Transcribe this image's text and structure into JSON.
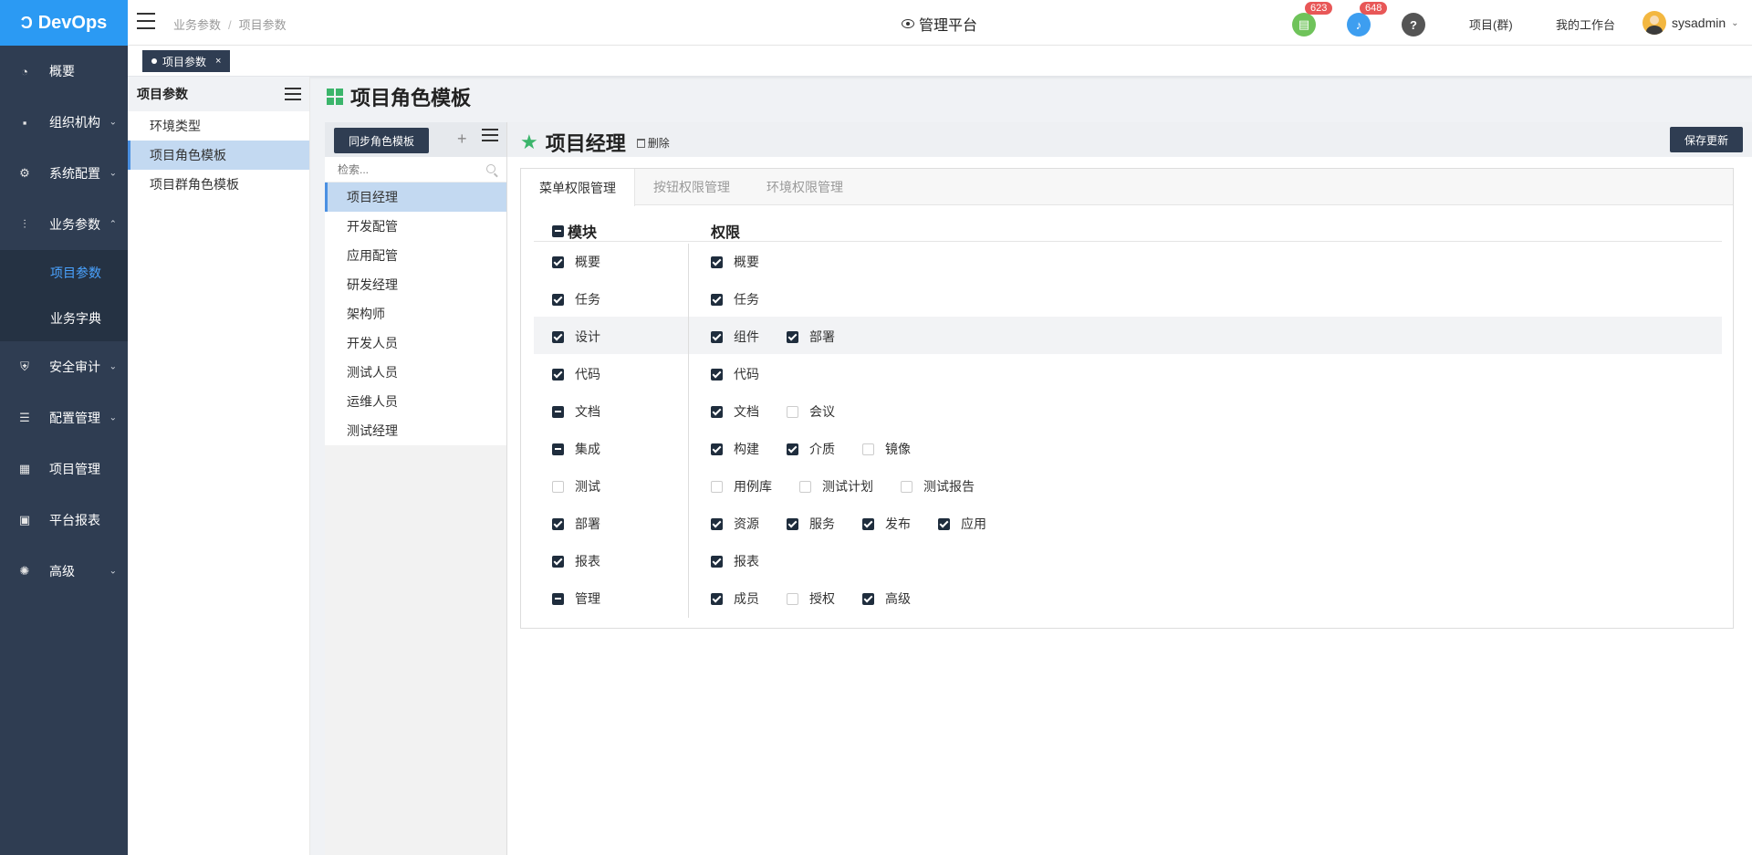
{
  "logo": {
    "text": "DevOps"
  },
  "sidebar": {
    "items": [
      {
        "label": "概要",
        "icon": "dashboard-icon"
      },
      {
        "label": "组织机构",
        "icon": "lock-icon"
      },
      {
        "label": "系统配置",
        "icon": "gear-icon"
      },
      {
        "label": "业务参数",
        "icon": "sliders-icon"
      },
      {
        "label": "安全审计",
        "icon": "shield-icon"
      },
      {
        "label": "配置管理",
        "icon": "database-icon"
      },
      {
        "label": "项目管理",
        "icon": "grid-icon"
      },
      {
        "label": "平台报表",
        "icon": "monitor-icon"
      },
      {
        "label": "高级",
        "icon": "cog-advanced-icon"
      }
    ],
    "subitems": [
      {
        "label": "项目参数",
        "active": true
      },
      {
        "label": "业务字典",
        "active": false
      }
    ]
  },
  "topbar": {
    "breadcrumb": [
      "业务参数",
      "项目参数"
    ],
    "breadcrumb_sep": "/",
    "platform": "管理平台",
    "badge_tasks": "623",
    "badge_notifications": "648",
    "help": "?",
    "project_group": "项目(群)",
    "workbench": "我的工作台",
    "username": "sysadmin",
    "colors": {
      "tasks": "#6fc35a",
      "notifications": "#3d9ef0",
      "help": "#555555"
    }
  },
  "tabstrip": {
    "tab_label": "项目参数",
    "close": "×"
  },
  "panel2": {
    "title": "项目参数",
    "items": [
      {
        "label": "环境类型"
      },
      {
        "label": "项目角色模板"
      },
      {
        "label": "项目群角色模板"
      }
    ]
  },
  "page": {
    "title": "项目角色模板"
  },
  "roles": {
    "sync_button": "同步角色模板",
    "add": "+",
    "search_placeholder": "检索...",
    "items": [
      "项目经理",
      "开发配管",
      "应用配管",
      "研发经理",
      "架构师",
      "开发人员",
      "测试人员",
      "运维人员",
      "测试经理"
    ]
  },
  "detail": {
    "role_title": "项目经理",
    "delete_label": "删除",
    "save_button": "保存更新",
    "tabs": [
      "菜单权限管理",
      "按钮权限管理",
      "环境权限管理"
    ],
    "col_module": "模块",
    "col_permission": "权限",
    "rows": [
      {
        "module": "概要",
        "state": "checked",
        "perms": [
          {
            "label": "概要",
            "checked": true
          }
        ]
      },
      {
        "module": "任务",
        "state": "checked",
        "perms": [
          {
            "label": "任务",
            "checked": true
          }
        ]
      },
      {
        "module": "设计",
        "state": "checked",
        "perms": [
          {
            "label": "组件",
            "checked": true
          },
          {
            "label": "部署",
            "checked": true
          }
        ]
      },
      {
        "module": "代码",
        "state": "checked",
        "perms": [
          {
            "label": "代码",
            "checked": true
          }
        ]
      },
      {
        "module": "文档",
        "state": "partial",
        "perms": [
          {
            "label": "文档",
            "checked": true
          },
          {
            "label": "会议",
            "checked": false
          }
        ]
      },
      {
        "module": "集成",
        "state": "partial",
        "perms": [
          {
            "label": "构建",
            "checked": true
          },
          {
            "label": "介质",
            "checked": true
          },
          {
            "label": "镜像",
            "checked": false
          }
        ]
      },
      {
        "module": "测试",
        "state": "empty",
        "perms": [
          {
            "label": "用例库",
            "checked": false
          },
          {
            "label": "测试计划",
            "checked": false
          },
          {
            "label": "测试报告",
            "checked": false
          }
        ]
      },
      {
        "module": "部署",
        "state": "checked",
        "perms": [
          {
            "label": "资源",
            "checked": true
          },
          {
            "label": "服务",
            "checked": true
          },
          {
            "label": "发布",
            "checked": true
          },
          {
            "label": "应用",
            "checked": true
          }
        ]
      },
      {
        "module": "报表",
        "state": "checked",
        "perms": [
          {
            "label": "报表",
            "checked": true
          }
        ]
      },
      {
        "module": "管理",
        "state": "partial",
        "perms": [
          {
            "label": "成员",
            "checked": true
          },
          {
            "label": "授权",
            "checked": false
          },
          {
            "label": "高级",
            "checked": true
          }
        ]
      }
    ]
  }
}
